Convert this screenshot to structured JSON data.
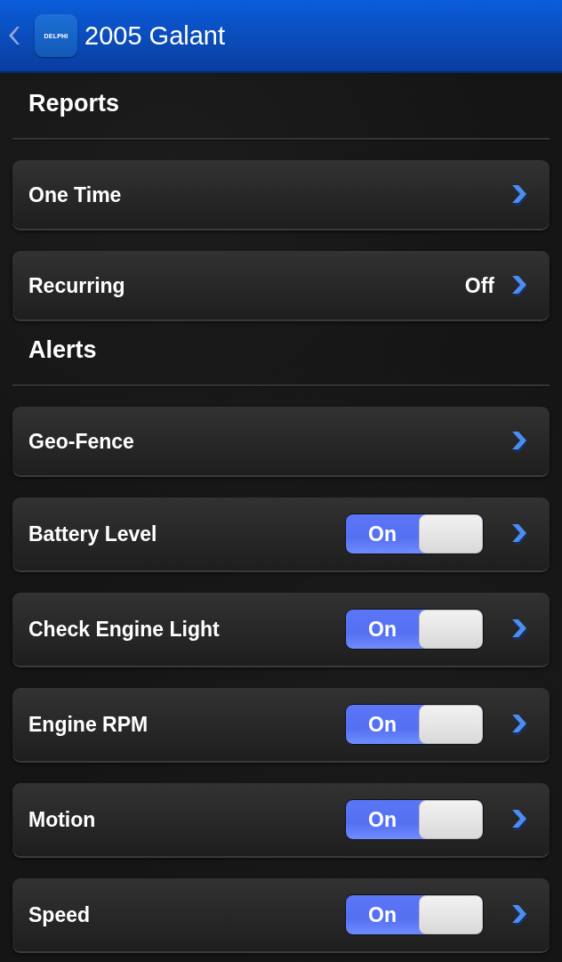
{
  "app_bar": {
    "logo_text": "DELPHI",
    "title": "2005 Galant"
  },
  "sections": [
    {
      "title": "Reports",
      "items": [
        {
          "kind": "link",
          "label": "One Time"
        },
        {
          "kind": "link",
          "label": "Recurring",
          "value": "Off"
        }
      ]
    },
    {
      "title": "Alerts",
      "items": [
        {
          "kind": "link",
          "label": "Geo-Fence"
        },
        {
          "kind": "toggle",
          "label": "Battery Level",
          "on": true,
          "toggle_label": "On"
        },
        {
          "kind": "toggle",
          "label": "Check Engine Light",
          "on": true,
          "toggle_label": "On"
        },
        {
          "kind": "toggle",
          "label": "Engine RPM",
          "on": true,
          "toggle_label": "On"
        },
        {
          "kind": "toggle",
          "label": "Motion",
          "on": true,
          "toggle_label": "On"
        },
        {
          "kind": "toggle",
          "label": "Speed",
          "on": true,
          "toggle_label": "On"
        }
      ]
    }
  ]
}
